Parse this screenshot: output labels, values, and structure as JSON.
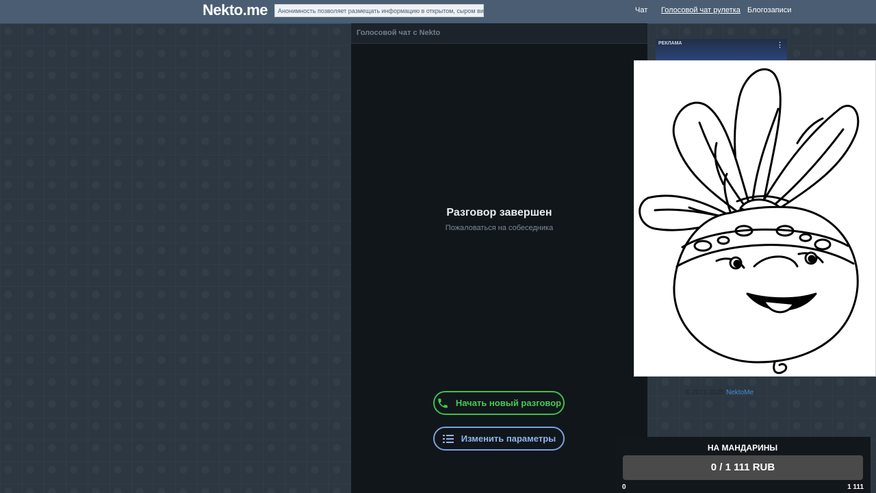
{
  "header": {
    "logo": "Nekto.me",
    "notice": "Анонимность позволяет размещать информацию в открытом, сыром виде!",
    "nav": {
      "chat": "Чат",
      "voice_roulette": "Голосовой чат рулетка",
      "blog": "Блогозаписи"
    }
  },
  "chat": {
    "header_title": "Голосовой чат с Nekto",
    "ended_title": "Разговор завершен",
    "complain_link": "Пожаловаться на собеседника",
    "new_chat_button": "Начать новый разговор",
    "params_button": "Изменить параметры",
    "icons": {
      "new_chat": "phone-icon",
      "params": "list-settings-icon"
    }
  },
  "sidebar": {
    "ad_label": "РЕКЛАМА",
    "ad_menu_icon": "more-vertical-icon",
    "overlay_image": "turnip-cartoon-coloring-image",
    "copyright_prefix": "© 2011-2025",
    "copyright_link": "NektoMe"
  },
  "donation": {
    "title": "НА МАНДАРИНЫ",
    "progress_text": "0 / 1 111 RUB",
    "progress_fraction": 0,
    "min_label": "0",
    "max_label": "1 111"
  },
  "colors": {
    "topbar": "#4a5d72",
    "green_accent": "#3fbf4c",
    "blue_accent": "#7aa3dd",
    "link": "#3f8fd8"
  }
}
